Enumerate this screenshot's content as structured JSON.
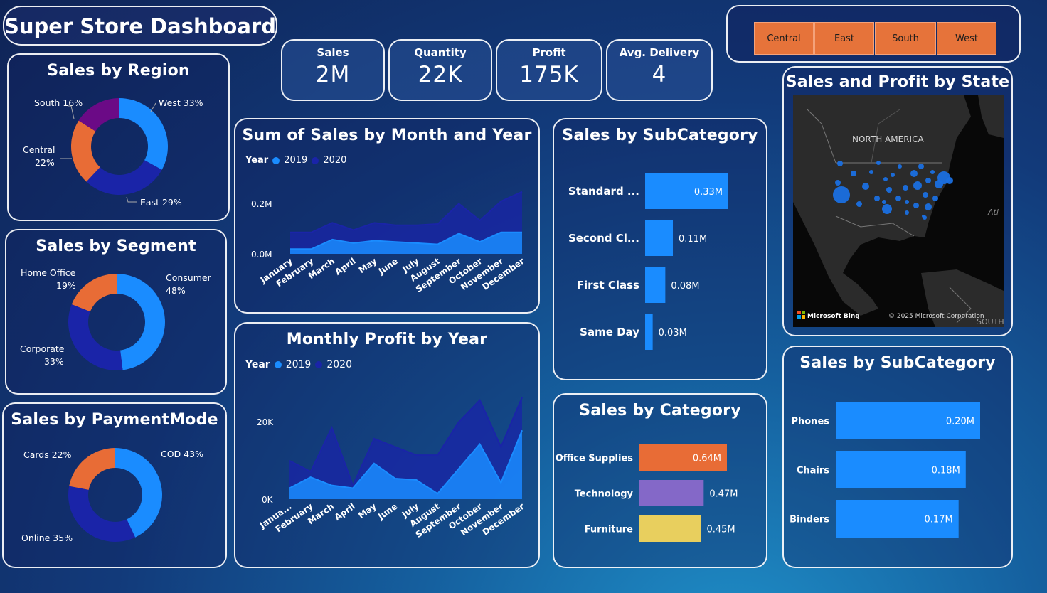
{
  "title": "Super Store Dashboard",
  "kpis": [
    {
      "label": "Sales",
      "value": "2M"
    },
    {
      "label": "Quantity",
      "value": "22K"
    },
    {
      "label": "Profit",
      "value": "175K"
    },
    {
      "label": "Avg. Delivery",
      "value": "4"
    }
  ],
  "slicer": {
    "items": [
      "Central",
      "East",
      "South",
      "West"
    ],
    "color": "#e6733a"
  },
  "colors": {
    "blue": "#1a8cff",
    "navy": "#1a24a8",
    "orange": "#e86c36",
    "purple": "#6b0a86",
    "violet": "#8468c8",
    "yellow": "#e8cf5e"
  },
  "region_chart": {
    "title": "Sales by Region",
    "slices": [
      {
        "name": "West",
        "label": "West 33%",
        "pct": 33,
        "color": "#1a8cff"
      },
      {
        "name": "East",
        "label": "East 29%",
        "pct": 29,
        "color": "#1a24a8"
      },
      {
        "name": "Central",
        "label": "Central\n22%",
        "pct": 22,
        "color": "#e86c36"
      },
      {
        "name": "South",
        "label": "South 16%",
        "pct": 16,
        "color": "#6b0a86"
      }
    ]
  },
  "segment_chart": {
    "title": "Sales by Segment",
    "slices": [
      {
        "name": "Consumer",
        "label": "Consumer\n48%",
        "pct": 48,
        "color": "#1a8cff"
      },
      {
        "name": "Corporate",
        "label": "Corporate\n33%",
        "pct": 33,
        "color": "#1a24a8"
      },
      {
        "name": "Home Office",
        "label": "Home Office\n19%",
        "pct": 19,
        "color": "#e86c36"
      }
    ]
  },
  "payment_chart": {
    "title": "Sales by PaymentMode",
    "slices": [
      {
        "name": "COD",
        "label": "COD 43%",
        "pct": 43,
        "color": "#1a8cff"
      },
      {
        "name": "Online",
        "label": "Online 35%",
        "pct": 35,
        "color": "#1a24a8"
      },
      {
        "name": "Cards",
        "label": "Cards 22%",
        "pct": 22,
        "color": "#e86c36"
      }
    ]
  },
  "sales_month_chart": {
    "title": "Sum of Sales by Month and Year",
    "legend_title": "Year",
    "series": [
      {
        "name": "2019",
        "color": "#1a8cff"
      },
      {
        "name": "2020",
        "color": "#1a24a8"
      }
    ],
    "y_ticks": [
      "0.2M",
      "0.0M"
    ]
  },
  "profit_month_chart": {
    "title": "Monthly Profit by Year",
    "legend_title": "Year",
    "series": [
      {
        "name": "2019",
        "color": "#1a8cff"
      },
      {
        "name": "2020",
        "color": "#1a24a8"
      }
    ],
    "y_ticks": [
      "20K",
      "0K"
    ]
  },
  "subcat_ship_chart": {
    "title": "Sales by SubCategory",
    "bars": [
      {
        "label": "Standard ...",
        "value_label": "0.33M",
        "value": 0.33
      },
      {
        "label": "Second Cl...",
        "value_label": "0.11M",
        "value": 0.11
      },
      {
        "label": "First Class",
        "value_label": "0.08M",
        "value": 0.08
      },
      {
        "label": "Same Day",
        "value_label": "0.03M",
        "value": 0.03
      }
    ]
  },
  "category_chart": {
    "title": "Sales by Category",
    "bars": [
      {
        "label": "Office Supplies",
        "value_label": "0.64M",
        "value": 0.64,
        "color": "#e86c36"
      },
      {
        "label": "Technology",
        "value_label": "0.47M",
        "value": 0.47,
        "color": "#8468c8"
      },
      {
        "label": "Furniture",
        "value_label": "0.45M",
        "value": 0.45,
        "color": "#e8cf5e"
      }
    ]
  },
  "map": {
    "title": "Sales and Profit by State",
    "continent_label": "NORTH AMERICA",
    "ocean_label": "Atl",
    "south_label": "SOUTH AI",
    "bing_label": "Microsoft Bing",
    "copyright": "© 2025 Microsoft Corporation"
  },
  "subcat_product_chart": {
    "title": "Sales by SubCategory",
    "bars": [
      {
        "label": "Phones",
        "value_label": "0.20M",
        "value": 0.2
      },
      {
        "label": "Chairs",
        "value_label": "0.18M",
        "value": 0.18
      },
      {
        "label": "Binders",
        "value_label": "0.17M",
        "value": 0.17
      }
    ]
  },
  "chart_data": [
    {
      "type": "area",
      "title": "Sum of Sales by Month and Year",
      "x": [
        "January",
        "February",
        "March",
        "April",
        "May",
        "June",
        "July",
        "August",
        "September",
        "October",
        "November",
        "December"
      ],
      "series": [
        {
          "name": "2019",
          "values": [
            0.02,
            0.02,
            0.06,
            0.045,
            0.055,
            0.05,
            0.045,
            0.04,
            0.085,
            0.05,
            0.09,
            0.09
          ]
        },
        {
          "name": "2020",
          "values": [
            0.09,
            0.09,
            0.13,
            0.1,
            0.13,
            0.12,
            0.12,
            0.125,
            0.21,
            0.14,
            0.22,
            0.26
          ]
        }
      ],
      "ylabel": "",
      "xlabel": "",
      "ylim": [
        0,
        0.28
      ]
    },
    {
      "type": "area",
      "title": "Monthly Profit by Year",
      "x": [
        "Janua...",
        "February",
        "March",
        "April",
        "May",
        "June",
        "July",
        "August",
        "September",
        "October",
        "November",
        "December"
      ],
      "series": [
        {
          "name": "2019",
          "values": [
            4000,
            8000,
            5000,
            4000,
            13000,
            7500,
            7000,
            2000,
            11000,
            20000,
            6000,
            25000
          ]
        },
        {
          "name": "2020",
          "values": [
            14000,
            10000,
            26000,
            5000,
            22000,
            19000,
            16000,
            16000,
            28000,
            36000,
            19000,
            37000
          ]
        }
      ],
      "ylabel": "",
      "xlabel": "",
      "ylim": [
        0,
        38000
      ]
    }
  ]
}
